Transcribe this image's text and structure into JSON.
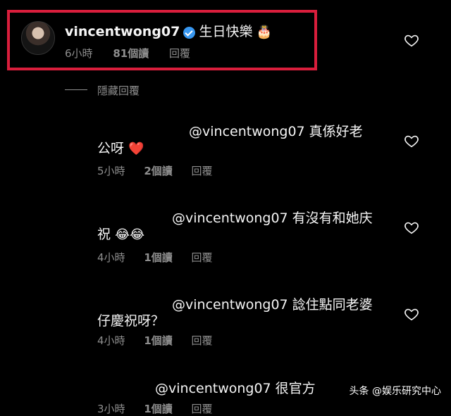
{
  "main_comment": {
    "username": "vincentwong07",
    "text": "生日快樂",
    "emoji": "🎂",
    "time": "6小時",
    "reads": "81個讀",
    "reply_label": "回覆"
  },
  "hide_replies_label": "隱藏回覆",
  "replies": [
    {
      "line1": "@vincentwong07 真係好老",
      "line2": "公呀",
      "emoji": "❤️",
      "time": "5小時",
      "reads": "2個讀",
      "reply_label": "回覆"
    },
    {
      "line1": "@vincentwong07 有沒有和她庆",
      "line2": "祝",
      "emoji": "😂😂",
      "time": "4小時",
      "reads": "1個讀",
      "reply_label": "回覆"
    },
    {
      "line1": "@vincentwong07 諗住點同老婆",
      "line2": "仔慶祝呀？",
      "emoji": "",
      "time": "4小時",
      "reads": "1個讀",
      "reply_label": "回覆"
    },
    {
      "line1": "@vincentwong07 很官方",
      "line2": "",
      "emoji": "",
      "time": "3小時",
      "reads": "1個讀",
      "reply_label": "回覆"
    }
  ],
  "watermark": "头条 @娱乐研究中心",
  "icons": {
    "like": "heart-outline-icon",
    "verified": "verified-badge-icon"
  },
  "colors": {
    "highlight": "#d91e3c",
    "verified": "#3897f0",
    "meta": "#8e8e8e"
  }
}
